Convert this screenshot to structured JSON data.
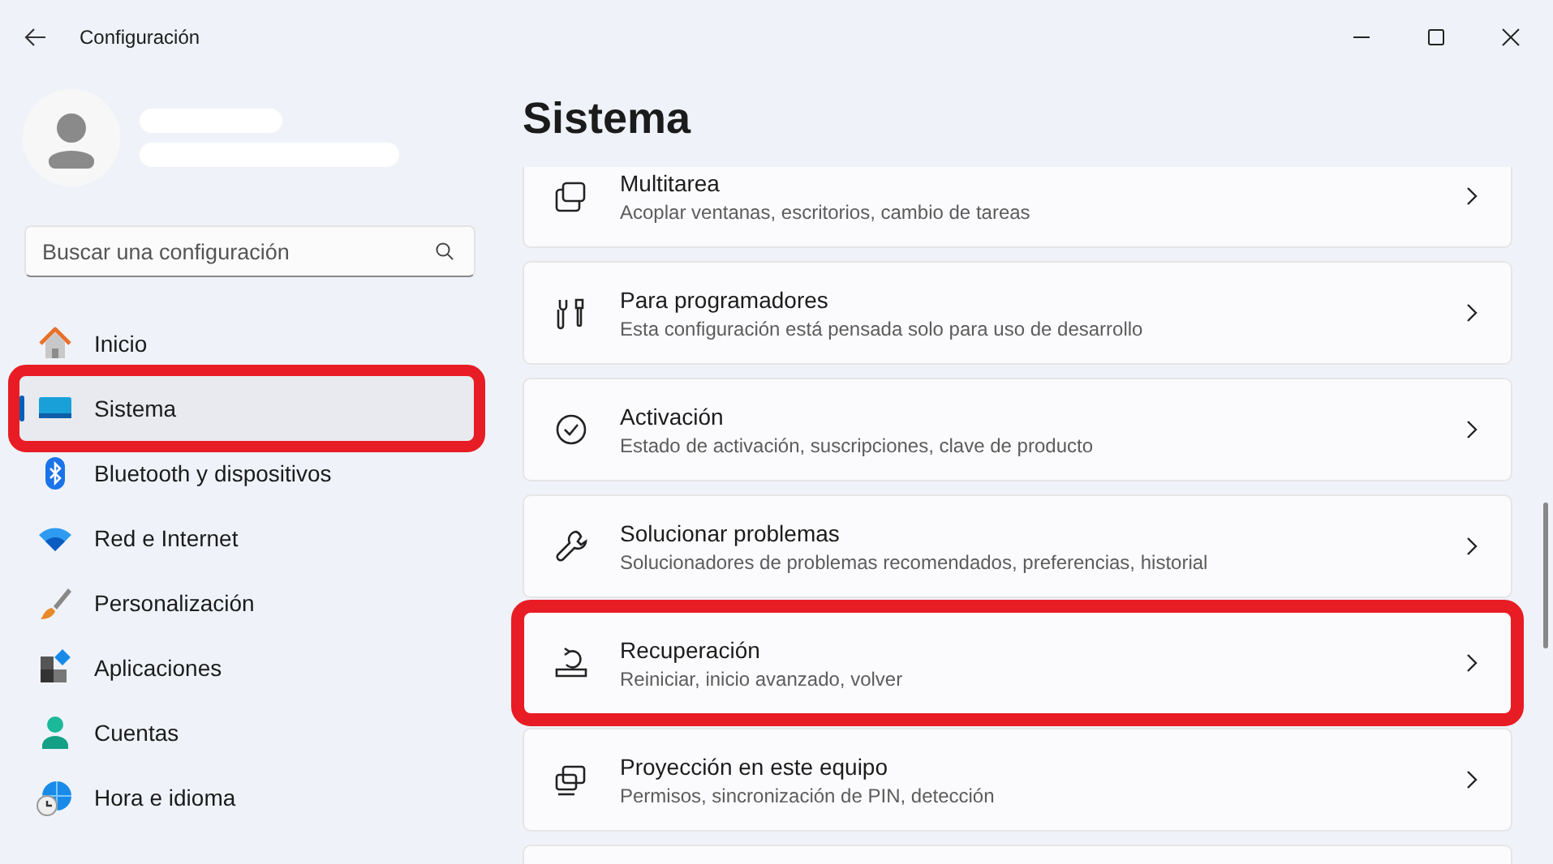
{
  "window": {
    "title": "Configuración"
  },
  "search": {
    "placeholder": "Buscar una configuración"
  },
  "sidebar": {
    "items": [
      {
        "label": "Inicio",
        "selected": false,
        "highlighted": false
      },
      {
        "label": "Sistema",
        "selected": true,
        "highlighted": true
      },
      {
        "label": "Bluetooth y dispositivos",
        "selected": false,
        "highlighted": false
      },
      {
        "label": "Red e Internet",
        "selected": false,
        "highlighted": false
      },
      {
        "label": "Personalización",
        "selected": false,
        "highlighted": false
      },
      {
        "label": "Aplicaciones",
        "selected": false,
        "highlighted": false
      },
      {
        "label": "Cuentas",
        "selected": false,
        "highlighted": false
      },
      {
        "label": "Hora e idioma",
        "selected": false,
        "highlighted": false
      }
    ]
  },
  "page": {
    "title": "Sistema"
  },
  "settings": [
    {
      "title": "Multitarea",
      "description": "Acoplar ventanas, escritorios, cambio de tareas",
      "highlighted": false
    },
    {
      "title": "Para programadores",
      "description": "Esta configuración está pensada solo para uso de desarrollo",
      "highlighted": false
    },
    {
      "title": "Activación",
      "description": "Estado de activación, suscripciones, clave de producto",
      "highlighted": false
    },
    {
      "title": "Solucionar problemas",
      "description": "Solucionadores de problemas recomendados, preferencias, historial",
      "highlighted": false
    },
    {
      "title": "Recuperación",
      "description": "Reiniciar, inicio avanzado, volver",
      "highlighted": true
    },
    {
      "title": "Proyección en este equipo",
      "description": "Permisos, sincronización de PIN, detección",
      "highlighted": false
    }
  ]
}
